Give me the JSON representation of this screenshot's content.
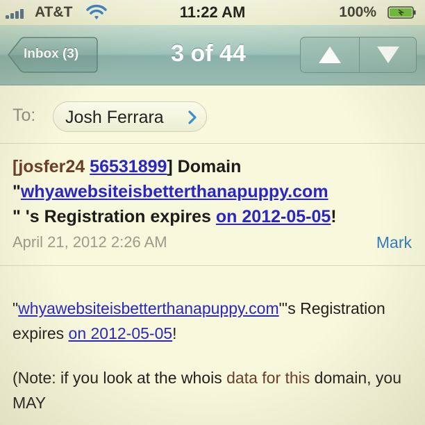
{
  "status_bar": {
    "carrier": "AT&T",
    "time": "11:22 AM",
    "battery_percent": "100%",
    "battery_level": 1.0,
    "signal_icon": "signal-bars-icon",
    "wifi_icon": "wifi-icon"
  },
  "nav": {
    "back_label": "Inbox (3)",
    "title": "3 of 44",
    "up_icon": "arrow-up-icon",
    "down_icon": "arrow-down-icon"
  },
  "header": {
    "to_label": "To:",
    "recipient": "Josh Ferrara",
    "subject_part1": "[josfer24 ",
    "subject_link1": "56531899",
    "subject_part2": "] Domain \"",
    "subject_link2": "whyawebsiteisbetterthanapuppy.com",
    "subject_part3": "\" 's Registration expires ",
    "subject_link3": "on 2012-05-05",
    "subject_part4": "!",
    "date": "April 21, 2012 2:26 AM",
    "mark_label": "Mark"
  },
  "body": {
    "p1_quote": "\"",
    "p1_link1": "whyawebsiteisbetterthanapuppy.com",
    "p1_text1": "\"'s Registration expires ",
    "p1_link2": "on 2012-05-05",
    "p1_text2": "!",
    "p2_text1": "(Note: if you look at the whois ",
    "p2_brown": "data for this",
    "p2_text2": " domain, you MAY"
  },
  "colors": {
    "background": "#f7f8dc",
    "link": "#2a25c9",
    "accent_blue": "#2f7bc1",
    "navbar": "#9fc2b8"
  }
}
